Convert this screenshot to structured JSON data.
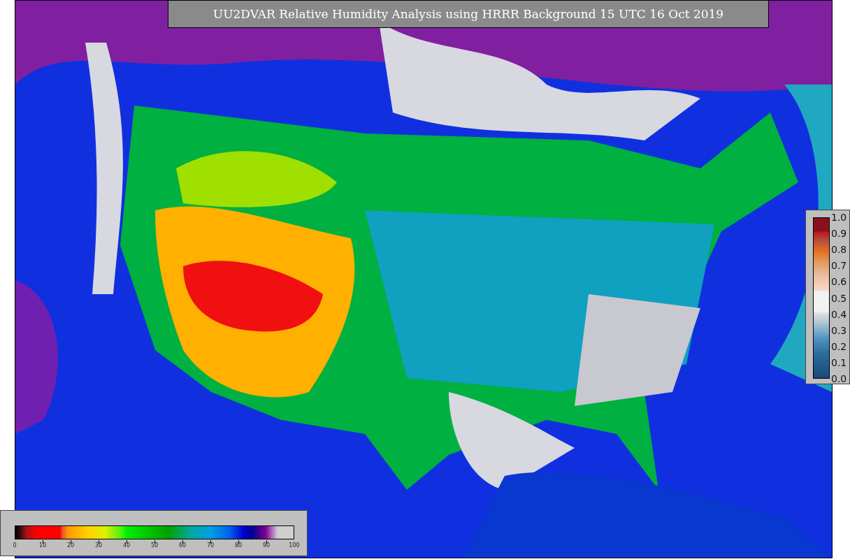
{
  "title": "UU2DVAR Relative Humidity Analysis using HRRR Background 15 UTC 16 Oct 2019",
  "humidity_colorbar": {
    "ticks": [
      "0",
      "10",
      "20",
      "30",
      "40",
      "50",
      "60",
      "70",
      "80",
      "90",
      "100"
    ]
  },
  "station_colorbar": {
    "ticks": [
      "1.0",
      "0.9",
      "0.8",
      "0.7",
      "0.6",
      "0.5",
      "0.4",
      "0.3",
      "0.2",
      "0.1",
      "0.0"
    ]
  }
}
